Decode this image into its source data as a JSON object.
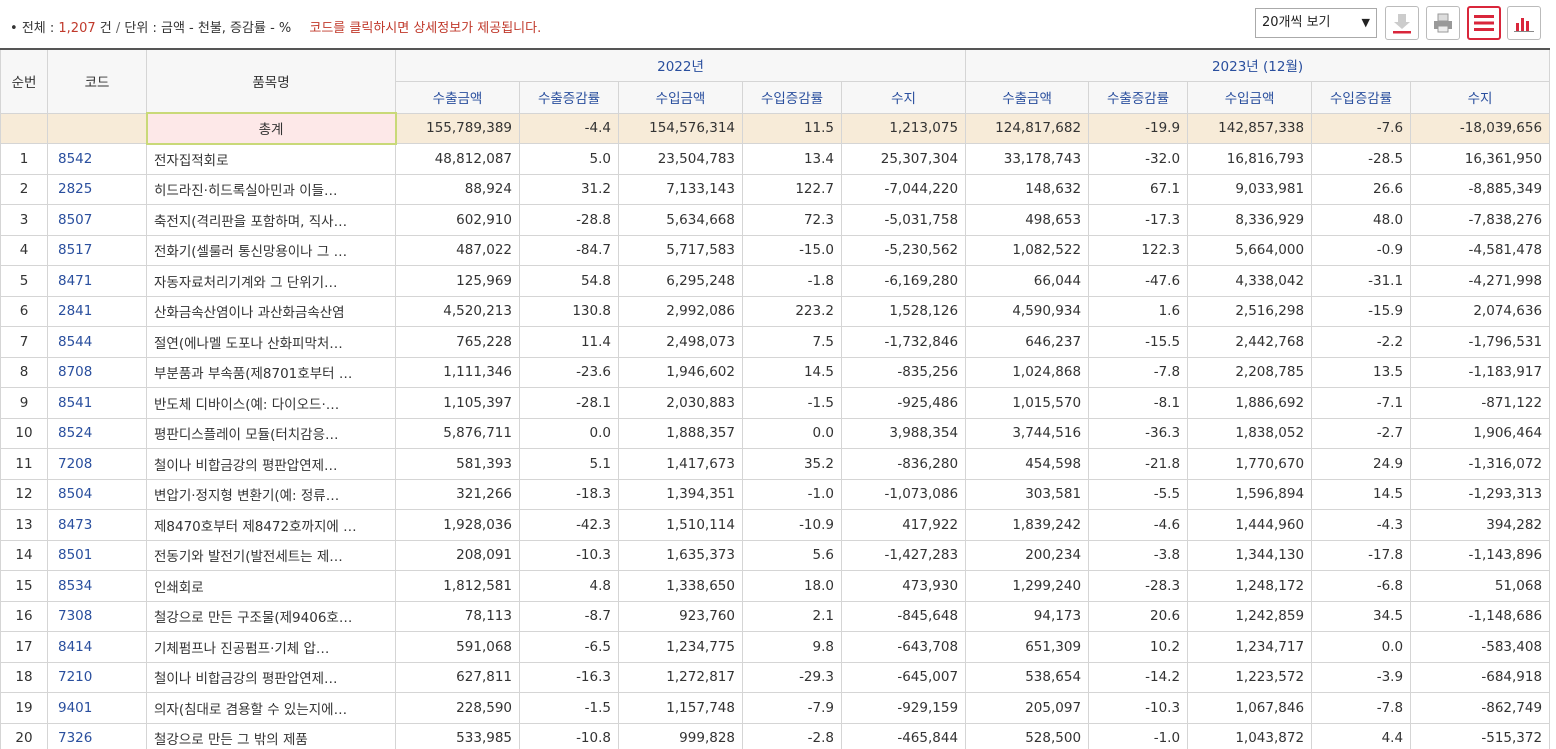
{
  "summary": {
    "bullet": "•",
    "total_label": "전체",
    "colon1": ":",
    "total_count": "1,207",
    "count_unit": "건",
    "slash": "/",
    "unit_label": "단위",
    "colon2": ":",
    "unit_text": "금액 - 천불, 증감률 - %",
    "notice": "코드를 클릭하시면 상세정보가 제공됩니다."
  },
  "toolbar": {
    "per_page_selected": "20개씩 보기",
    "buttons": [
      {
        "name": "download-icon",
        "color": "#d9263b"
      },
      {
        "name": "print-icon",
        "color": "#777777"
      },
      {
        "name": "list-view-icon",
        "color": "#d9263b"
      },
      {
        "name": "chart-view-icon",
        "color": "#d9263b"
      }
    ]
  },
  "table": {
    "headers": {
      "seq": "순번",
      "code": "코드",
      "item": "품목명",
      "period1": "2022년",
      "period2": "2023년 (12월)",
      "sub": [
        "수출금액",
        "수출증감률",
        "수입금액",
        "수입증감률",
        "수지",
        "수출금액",
        "수출증감률",
        "수입금액",
        "수입증감률",
        "수지"
      ]
    },
    "total": {
      "label": "총계",
      "values": [
        "155,789,389",
        "-4.4",
        "154,576,314",
        "11.5",
        "1,213,075",
        "124,817,682",
        "-19.9",
        "142,857,338",
        "-7.6",
        "-18,039,656"
      ]
    },
    "rows": [
      {
        "seq": "1",
        "code": "8542",
        "name": "전자집적회로",
        "values": [
          "48,812,087",
          "5.0",
          "23,504,783",
          "13.4",
          "25,307,304",
          "33,178,743",
          "-32.0",
          "16,816,793",
          "-28.5",
          "16,361,950"
        ]
      },
      {
        "seq": "2",
        "code": "2825",
        "name": "히드라진·히드록실아민과 이들…",
        "values": [
          "88,924",
          "31.2",
          "7,133,143",
          "122.7",
          "-7,044,220",
          "148,632",
          "67.1",
          "9,033,981",
          "26.6",
          "-8,885,349"
        ]
      },
      {
        "seq": "3",
        "code": "8507",
        "name": "축전지(격리판을 포함하며, 직사…",
        "values": [
          "602,910",
          "-28.8",
          "5,634,668",
          "72.3",
          "-5,031,758",
          "498,653",
          "-17.3",
          "8,336,929",
          "48.0",
          "-7,838,276"
        ]
      },
      {
        "seq": "4",
        "code": "8517",
        "name": "전화기(셀룰러 통신망용이나 그 …",
        "values": [
          "487,022",
          "-84.7",
          "5,717,583",
          "-15.0",
          "-5,230,562",
          "1,082,522",
          "122.3",
          "5,664,000",
          "-0.9",
          "-4,581,478"
        ]
      },
      {
        "seq": "5",
        "code": "8471",
        "name": "자동자료처리기계와 그 단위기…",
        "values": [
          "125,969",
          "54.8",
          "6,295,248",
          "-1.8",
          "-6,169,280",
          "66,044",
          "-47.6",
          "4,338,042",
          "-31.1",
          "-4,271,998"
        ]
      },
      {
        "seq": "6",
        "code": "2841",
        "name": "산화금속산염이나 과산화금속산염",
        "values": [
          "4,520,213",
          "130.8",
          "2,992,086",
          "223.2",
          "1,528,126",
          "4,590,934",
          "1.6",
          "2,516,298",
          "-15.9",
          "2,074,636"
        ]
      },
      {
        "seq": "7",
        "code": "8544",
        "name": "절연(에나멜 도포나 산화피막처…",
        "values": [
          "765,228",
          "11.4",
          "2,498,073",
          "7.5",
          "-1,732,846",
          "646,237",
          "-15.5",
          "2,442,768",
          "-2.2",
          "-1,796,531"
        ]
      },
      {
        "seq": "8",
        "code": "8708",
        "name": "부분품과 부속품(제8701호부터 …",
        "values": [
          "1,111,346",
          "-23.6",
          "1,946,602",
          "14.5",
          "-835,256",
          "1,024,868",
          "-7.8",
          "2,208,785",
          "13.5",
          "-1,183,917"
        ]
      },
      {
        "seq": "9",
        "code": "8541",
        "name": "반도체 디바이스(예: 다이오드·…",
        "values": [
          "1,105,397",
          "-28.1",
          "2,030,883",
          "-1.5",
          "-925,486",
          "1,015,570",
          "-8.1",
          "1,886,692",
          "-7.1",
          "-871,122"
        ]
      },
      {
        "seq": "10",
        "code": "8524",
        "name": "평판디스플레이 모듈(터치감응…",
        "values": [
          "5,876,711",
          "0.0",
          "1,888,357",
          "0.0",
          "3,988,354",
          "3,744,516",
          "-36.3",
          "1,838,052",
          "-2.7",
          "1,906,464"
        ]
      },
      {
        "seq": "11",
        "code": "7208",
        "name": "철이나 비합금강의 평판압연제…",
        "values": [
          "581,393",
          "5.1",
          "1,417,673",
          "35.2",
          "-836,280",
          "454,598",
          "-21.8",
          "1,770,670",
          "24.9",
          "-1,316,072"
        ]
      },
      {
        "seq": "12",
        "code": "8504",
        "name": "변압기·정지형 변환기(예: 정류…",
        "values": [
          "321,266",
          "-18.3",
          "1,394,351",
          "-1.0",
          "-1,073,086",
          "303,581",
          "-5.5",
          "1,596,894",
          "14.5",
          "-1,293,313"
        ]
      },
      {
        "seq": "13",
        "code": "8473",
        "name": "제8470호부터 제8472호까지에 …",
        "values": [
          "1,928,036",
          "-42.3",
          "1,510,114",
          "-10.9",
          "417,922",
          "1,839,242",
          "-4.6",
          "1,444,960",
          "-4.3",
          "394,282"
        ]
      },
      {
        "seq": "14",
        "code": "8501",
        "name": "전동기와 발전기(발전세트는 제…",
        "values": [
          "208,091",
          "-10.3",
          "1,635,373",
          "5.6",
          "-1,427,283",
          "200,234",
          "-3.8",
          "1,344,130",
          "-17.8",
          "-1,143,896"
        ]
      },
      {
        "seq": "15",
        "code": "8534",
        "name": "인쇄회로",
        "values": [
          "1,812,581",
          "4.8",
          "1,338,650",
          "18.0",
          "473,930",
          "1,299,240",
          "-28.3",
          "1,248,172",
          "-6.8",
          "51,068"
        ]
      },
      {
        "seq": "16",
        "code": "7308",
        "name": "철강으로 만든 구조물(제9406호…",
        "values": [
          "78,113",
          "-8.7",
          "923,760",
          "2.1",
          "-845,648",
          "94,173",
          "20.6",
          "1,242,859",
          "34.5",
          "-1,148,686"
        ]
      },
      {
        "seq": "17",
        "code": "8414",
        "name": "기체펌프나 진공펌프·기체 압…",
        "values": [
          "591,068",
          "-6.5",
          "1,234,775",
          "9.8",
          "-643,708",
          "651,309",
          "10.2",
          "1,234,717",
          "0.0",
          "-583,408"
        ]
      },
      {
        "seq": "18",
        "code": "7210",
        "name": "철이나 비합금강의 평판압연제…",
        "values": [
          "627,811",
          "-16.3",
          "1,272,817",
          "-29.3",
          "-645,007",
          "538,654",
          "-14.2",
          "1,223,572",
          "-3.9",
          "-684,918"
        ]
      },
      {
        "seq": "19",
        "code": "9401",
        "name": "의자(침대로 겸용할 수 있는지에…",
        "values": [
          "228,590",
          "-1.5",
          "1,157,748",
          "-7.9",
          "-929,159",
          "205,097",
          "-10.3",
          "1,067,846",
          "-7.8",
          "-862,749"
        ]
      },
      {
        "seq": "20",
        "code": "7326",
        "name": "철강으로 만든 그 밖의 제품",
        "values": [
          "533,985",
          "-10.8",
          "999,828",
          "-2.8",
          "-465,844",
          "528,500",
          "-1.0",
          "1,043,872",
          "4.4",
          "-515,372"
        ]
      }
    ]
  }
}
